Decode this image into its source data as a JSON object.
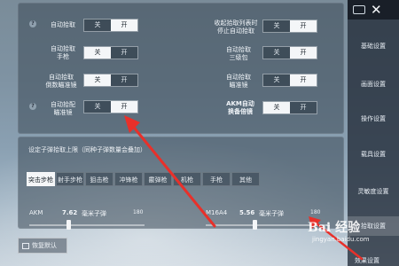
{
  "pickup": {
    "rows": [
      {
        "label": "自动拾取",
        "off": "关",
        "on": "开",
        "selected": "开"
      },
      {
        "label": "自动拾取\n手枪",
        "off": "关",
        "on": "开",
        "selected": "关"
      },
      {
        "label": "自动拾取\n倒数瞄准镜",
        "off": "关",
        "on": "开",
        "selected": "关"
      },
      {
        "label": "自动拾配\n瞄准镜",
        "off": "关",
        "on": "开",
        "selected": "开"
      },
      {
        "label": "收起拾取列表时\n停止自动拾取",
        "off": "关",
        "on": "开",
        "selected": "开"
      },
      {
        "label": "自动拾取\n三级包",
        "off": "关",
        "on": "开",
        "selected": "开"
      },
      {
        "label": "自动拾取\n瞄准镜",
        "off": "关",
        "on": "开",
        "selected": "开"
      },
      {
        "label": "AKM自动\n换备倍镜",
        "off": "关",
        "on": "开",
        "selected": "关"
      }
    ]
  },
  "ammo": {
    "title": "设定子弹拾取上限（同种子弹数量会叠加）",
    "tabs": [
      "突击步枪",
      "射手步枪",
      "狙击枪",
      "冲锋枪",
      "霰弹枪",
      "机枪",
      "手枪",
      "其他"
    ],
    "active_tab": "突击步枪",
    "weapons": [
      {
        "name": "AKM",
        "value": "7.62",
        "unit": "毫米子弹",
        "max": "180",
        "level": 0.32
      },
      {
        "name": "M16A4",
        "value": "5.56",
        "unit": "毫米子弹",
        "max": "180",
        "level": 0.38
      }
    ]
  },
  "restore_label": "恢复默认",
  "sidebar": {
    "close": "✕",
    "items": [
      {
        "label": "基础设置",
        "active": false
      },
      {
        "label": "画面设置",
        "active": false
      },
      {
        "label": "操作设置",
        "active": false
      },
      {
        "label": "载具设置",
        "active": false
      },
      {
        "label": "灵敏度设置",
        "active": false
      },
      {
        "label": "拾取设置",
        "active": true
      },
      {
        "label": "效果设置",
        "active": false
      }
    ]
  },
  "watermark": {
    "logo": "Bai 经验",
    "url": "jingyan.baidu.com"
  },
  "colors": {
    "accent_arrow": "#e8302a",
    "selected_segment": "#f4f6f8"
  }
}
